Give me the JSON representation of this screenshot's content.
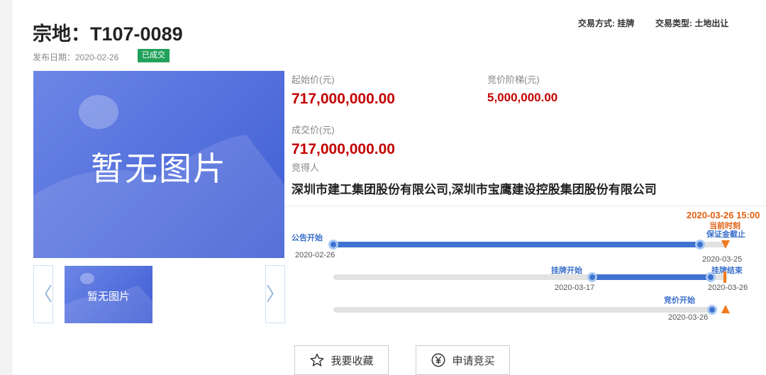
{
  "header": {
    "title": "宗地：T107-0089",
    "trade_method": "交易方式: 挂牌",
    "trade_type": "交易类型: 土地出让",
    "publish_date": "发布日期：2020-02-26",
    "status": "已成交"
  },
  "gallery": {
    "placeholder": "暂无图片",
    "thumb_placeholder": "暂无图片",
    "prev_glyph": "〈",
    "next_glyph": "〉"
  },
  "prices": {
    "start_label": "起始价(元)",
    "start_value": "717,000,000.00",
    "step_label": "竞价阶梯(元)",
    "step_value": "5,000,000.00",
    "deal_label": "成交价(元)",
    "deal_value": "717,000,000.00",
    "winner_label": "竞得人",
    "winner_value": "深圳市建工集团股份有限公司,深圳市宝鹰建设控股集团股份有限公司"
  },
  "timeline": {
    "now_time": "2020-03-26 15:00",
    "now_label": "当前时刻",
    "row1": {
      "start_label": "公告开始",
      "start_date": "2020-02-26",
      "end_label": "保证金截止",
      "end_date": "2020-03-25"
    },
    "row2": {
      "start_label": "挂牌开始",
      "start_date": "2020-03-17",
      "end_label": "挂牌结束",
      "end_date": "2020-03-26"
    },
    "row3": {
      "start_label": "竞价开始",
      "start_date": "2020-03-26"
    }
  },
  "actions": {
    "favorite_label": "我要收藏",
    "apply_label": "申请竞买"
  },
  "colors": {
    "accent_blue": "#3f72d0",
    "price_red": "#c40000",
    "status_green": "#21a15a",
    "now_orange": "#e06010"
  }
}
